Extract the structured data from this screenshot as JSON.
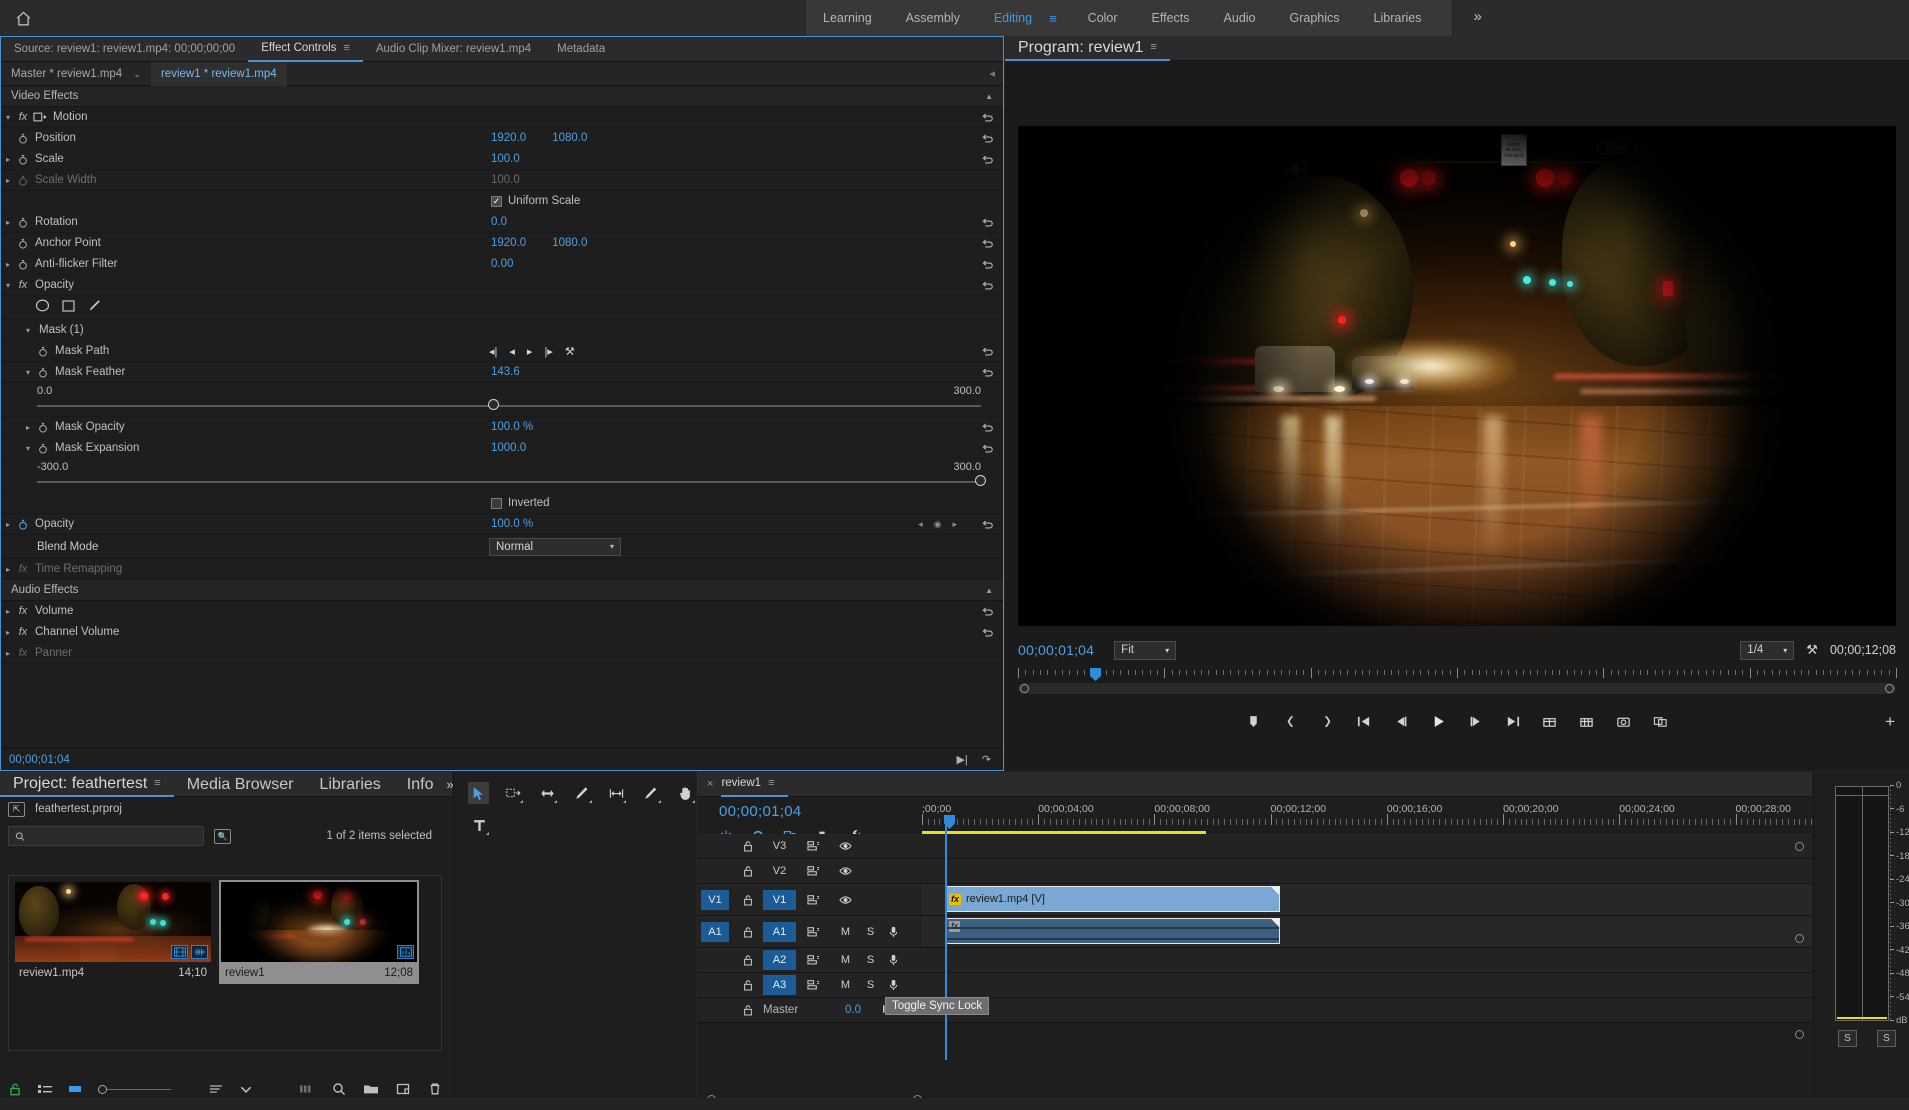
{
  "app": {
    "home_icon": "home-icon",
    "workspaces": [
      {
        "label": "Learning",
        "active": false
      },
      {
        "label": "Assembly",
        "active": false
      },
      {
        "label": "Editing",
        "active": true
      },
      {
        "label": "Color",
        "active": false
      },
      {
        "label": "Effects",
        "active": false
      },
      {
        "label": "Audio",
        "active": false
      },
      {
        "label": "Graphics",
        "active": false
      },
      {
        "label": "Libraries",
        "active": false
      }
    ],
    "more_workspaces": "»"
  },
  "effect_controls": {
    "tabs": [
      {
        "label": "Source: review1: review1.mp4: 00;00;00;00",
        "active": false
      },
      {
        "label": "Effect Controls",
        "active": true,
        "menu": "≡"
      },
      {
        "label": "Audio Clip Mixer: review1.mp4",
        "active": false
      },
      {
        "label": "Metadata",
        "active": false
      }
    ],
    "subtabs": [
      {
        "label": "Master * review1.mp4",
        "selected": false,
        "caret": "⌄"
      },
      {
        "label": "review1 * review1.mp4",
        "selected": true
      }
    ],
    "video_effects_header": "Video Effects",
    "audio_effects_header": "Audio Effects",
    "motion": {
      "name": "Motion",
      "params": [
        {
          "name": "Position",
          "values": [
            "1920.0",
            "1080.0"
          ],
          "disabled": false,
          "expandable": false
        },
        {
          "name": "Scale",
          "values": [
            "100.0"
          ],
          "disabled": false,
          "expandable": true
        },
        {
          "name": "Scale Width",
          "values": [
            "100.0"
          ],
          "disabled": true,
          "expandable": true
        },
        {
          "name": "Rotation",
          "values": [
            "0.0"
          ],
          "disabled": false,
          "expandable": true
        },
        {
          "name": "Anchor Point",
          "values": [
            "1920.0",
            "1080.0"
          ],
          "disabled": false,
          "expandable": false
        },
        {
          "name": "Anti-flicker Filter",
          "values": [
            "0.00"
          ],
          "disabled": false,
          "expandable": true
        }
      ],
      "uniform_scale": {
        "label": "Uniform Scale",
        "checked": true
      }
    },
    "opacity_group": {
      "name": "Opacity",
      "mask_name": "Mask (1)",
      "mask_path": {
        "label": "Mask Path"
      },
      "mask_feather": {
        "label": "Mask Feather",
        "value": "143.6",
        "min": "0.0",
        "max": "300.0",
        "knob_pct": 47.8
      },
      "mask_opacity": {
        "label": "Mask Opacity",
        "value": "100.0 %"
      },
      "mask_expansion": {
        "label": "Mask Expansion",
        "value": "1000.0",
        "min": "-300.0",
        "max": "300.0",
        "knob_pct": 100
      },
      "inverted": {
        "label": "Inverted",
        "checked": false
      },
      "opacity": {
        "label": "Opacity",
        "value": "100.0 %"
      },
      "blend_mode": {
        "label": "Blend Mode",
        "value": "Normal"
      }
    },
    "time_remapping": {
      "name": "Time Remapping",
      "disabled": true
    },
    "audio_effects": [
      {
        "name": "Volume",
        "disabled": false
      },
      {
        "name": "Channel Volume",
        "disabled": false
      },
      {
        "name": "Panner",
        "disabled": true
      }
    ],
    "footer_timecode": "00;00;01;04"
  },
  "program_monitor": {
    "tab_label": "Program: review1",
    "tab_menu": "≡",
    "timecode_current": "00;00;01;04",
    "fit_label": "Fit",
    "quality_label": "1/4",
    "timecode_duration": "00;00;12;08",
    "wrench_icon": "wrench-icon",
    "plus_icon": "plus-icon",
    "video_street_sign": "Cesar Chavez",
    "video_notice_sign": "DONT BLOCK\nTHE BOX",
    "buttons": [
      "add-marker-icon",
      "mark-in-icon",
      "mark-out-icon",
      "go-to-in-icon",
      "step-back-icon",
      "play-icon",
      "step-forward-icon",
      "go-to-out-icon",
      "lift-icon",
      "extract-icon",
      "export-frame-icon",
      "comparison-view-icon"
    ]
  },
  "project_panel": {
    "tabs": [
      {
        "label": "Project: feathertest",
        "active": true,
        "menu": "≡"
      },
      {
        "label": "Media Browser",
        "active": false
      },
      {
        "label": "Libraries",
        "active": false
      },
      {
        "label": "Info",
        "active": false
      }
    ],
    "more": "»",
    "breadcrumb": "feathertest.prproj",
    "search_placeholder": "",
    "search_value": "",
    "selection_status": "1 of 2 items selected",
    "items": [
      {
        "name": "review1.mp4",
        "duration": "14;10",
        "selected": false,
        "badges": [
          "video-icon",
          "audio-icon"
        ]
      },
      {
        "name": "review1",
        "duration": "12;08",
        "selected": true,
        "badges": [
          "sequence-icon"
        ]
      }
    ],
    "toolbar": [
      "lock-icon",
      "list-view-icon",
      "icon-view-icon",
      "zoom-slider",
      "sort-icon",
      "sort-chevron-icon",
      "freeform-icon",
      "find-icon",
      "new-bin-icon",
      "new-item-icon",
      "clear-icon"
    ]
  },
  "tools_panel": {
    "tools": [
      {
        "name": "selection-tool",
        "active": true
      },
      {
        "name": "track-select-forward-tool",
        "active": false
      },
      {
        "name": "ripple-edit-tool",
        "active": false
      },
      {
        "name": "razor-tool",
        "active": false
      },
      {
        "name": "slip-tool",
        "active": false
      },
      {
        "name": "pen-tool",
        "active": false
      },
      {
        "name": "hand-tool",
        "active": false
      },
      {
        "name": "type-tool",
        "active": false
      }
    ]
  },
  "timeline": {
    "tab_label": "review1",
    "tab_menu": "≡",
    "close": "×",
    "timecode": "00;00;01;04",
    "header_icons": [
      "nest-icon",
      "snap-icon",
      "linked-selection-icon",
      "add-marker-icon",
      "timeline-settings-icon"
    ],
    "ruler_labels": [
      ";00;00",
      "00;00;04;00",
      "00;00;08;00",
      "00;00;12;00",
      "00;00;16;00",
      "00;00;20;00",
      "00;00;24;00",
      "00;00;28;00"
    ],
    "tracks": [
      {
        "name": "V3",
        "type": "video",
        "source_target": false,
        "target": false,
        "locked": false
      },
      {
        "name": "V2",
        "type": "video",
        "source_target": false,
        "target": false,
        "locked": false
      },
      {
        "name": "V1",
        "type": "video",
        "source_target": true,
        "target": true,
        "locked": false
      },
      {
        "name": "A1",
        "type": "audio",
        "source_target": true,
        "target": true,
        "mute": "M",
        "solo": "S"
      },
      {
        "name": "A2",
        "type": "audio",
        "source_target": false,
        "target": true,
        "mute": "M",
        "solo": "S"
      },
      {
        "name": "A3",
        "type": "audio",
        "source_target": false,
        "target": true,
        "mute": "M",
        "solo": "S"
      }
    ],
    "master_track": {
      "label": "Master",
      "value": "0.0"
    },
    "clips": [
      {
        "track": "V1",
        "label": "review1.mp4 [V]",
        "has_fx": true
      },
      {
        "track": "A1",
        "label": "",
        "has_fx": true
      }
    ],
    "tooltip": "Toggle Sync Lock"
  },
  "audio_meters": {
    "scale": [
      "0",
      "-6",
      "-12",
      "-18",
      "-24",
      "-30",
      "-36",
      "-42",
      "-48",
      "-54",
      "dB"
    ],
    "solo_buttons": [
      "S",
      "S"
    ]
  },
  "colors": {
    "accent_blue": "#4f9fe0",
    "panel_bg": "#1e1e1e",
    "chrome_bg": "#2b2b2b",
    "track_target": "#1c5b96",
    "clip_video": "#7aa7d4",
    "clip_audio": "#3f5f80",
    "work_area_yellow": "#e2e21a"
  }
}
